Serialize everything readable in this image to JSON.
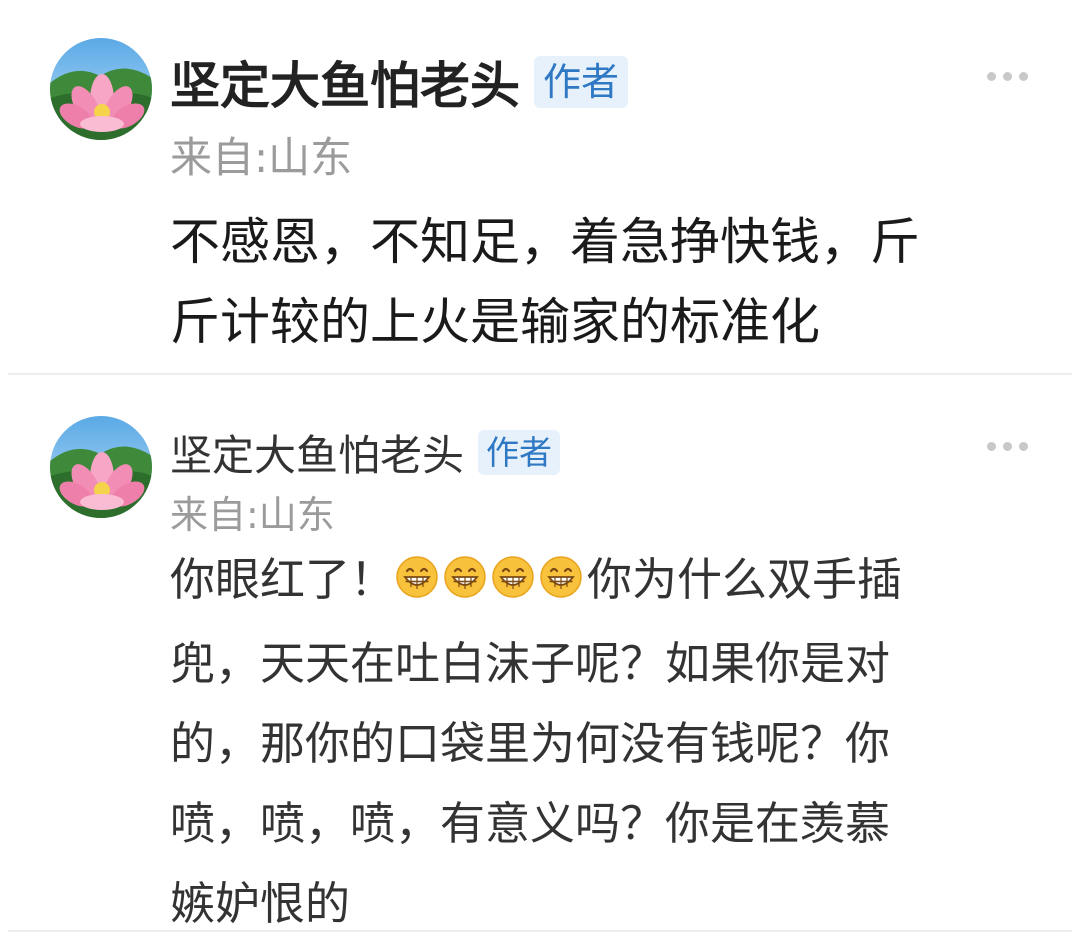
{
  "comments": [
    {
      "author": "坚定大鱼怕老头",
      "badge": "作者",
      "location": "来自:山东",
      "avatar_icon": "lotus-avatar-icon",
      "more_icon": "more-dots-icon",
      "lines": [
        "不感恩，不知足，着急挣快钱，斤",
        "斤计较的上火是输家的标准化"
      ]
    },
    {
      "author": "坚定大鱼怕老头",
      "badge": "作者",
      "location": "来自:山东",
      "avatar_icon": "lotus-avatar-icon",
      "more_icon": "more-dots-icon",
      "line1_before": "你眼红了！",
      "emoji_icon": "grinning-face-emoji",
      "emoji_count": 4,
      "line1_after": "你为什么双手插",
      "lines": [
        "兜，天天在吐白沫子呢？如果你是对",
        "的，那你的口袋里为何没有钱呢？你",
        "喷，喷，喷，有意义吗？你是在羡慕",
        "嫉妒恨的"
      ]
    }
  ],
  "colors": {
    "badge_bg": "#e6f1fb",
    "badge_text": "#2f78c4",
    "meta_text": "#9b9b9b",
    "body_text": "#1a1a1a"
  }
}
